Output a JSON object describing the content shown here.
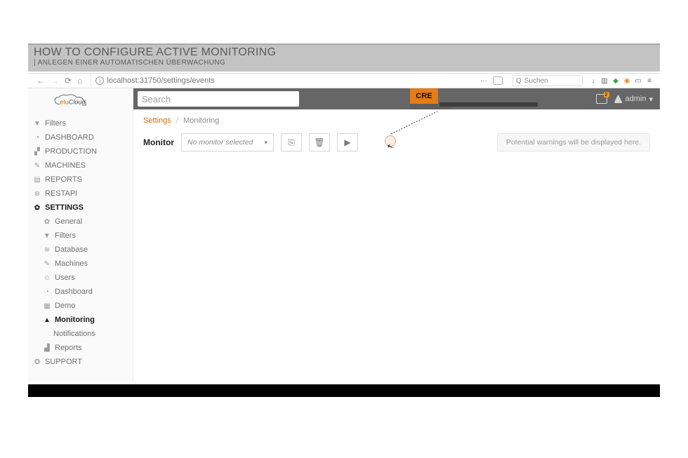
{
  "title_band": {
    "main": "HOW TO CONFIGURE ACTIVE MONITORING",
    "sub": "| ANLEGEN EINER AUTOMATISCHEN ÜBERWACHUNG"
  },
  "browser": {
    "url": "localhost:31750/settings/events",
    "search_placeholder": "Suchen",
    "search_icon": "Q",
    "dots": "···"
  },
  "logo": {
    "pre": "elu",
    "post": "Cloud"
  },
  "sidebar": {
    "filters": "Filters",
    "dashboard": "DASHBOARD",
    "production": "PRODUCTION",
    "machines": "MACHINES",
    "reports": "REPORTS",
    "restapi": "RESTAPI",
    "settings": "SETTINGS",
    "general": "General",
    "sfilters": "Filters",
    "database": "Database",
    "smachines": "Machines",
    "users": "Users",
    "sdashboard": "Dashboard",
    "demo": "Demo",
    "monitoring": "Monitoring",
    "notifications": "Notifications",
    "sreports": "Reports",
    "support": "SUPPORT"
  },
  "topbar": {
    "search_placeholder": "Search",
    "cre_tag": "CRE",
    "badge": "2",
    "admin_label": "admin",
    "caret": "▾"
  },
  "crumbs": {
    "root": "Settings",
    "sep": "/",
    "current": "Monitoring"
  },
  "toolbar": {
    "label": "Monitor",
    "dd_text": "No monitor selected",
    "caret": "▾",
    "save_ic": "⎘",
    "delete_ic": "🗑",
    "play_ic": "▶"
  },
  "banner": {
    "text": "Potential warnings will be displayed here."
  }
}
